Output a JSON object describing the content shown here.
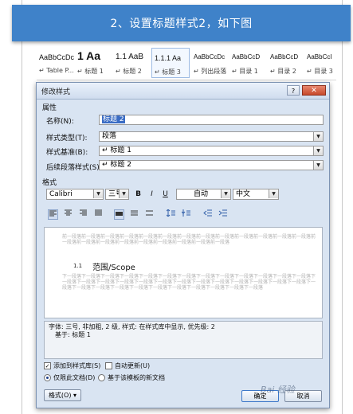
{
  "banner": {
    "text": "2、设置标题样式2，如下图"
  },
  "gallery": {
    "tiles": [
      {
        "sample": "AaBbCcDc",
        "name": "↵ Table P..."
      },
      {
        "sample": "1  Aa",
        "name": "↵ 标题 1"
      },
      {
        "sample": "1.1 AaB",
        "name": "↵ 标题 2"
      },
      {
        "sample": "1.1.1 Aa",
        "name": "↵ 标题 3"
      },
      {
        "sample": "AaBbCcDc",
        "name": "↵ 列出段落"
      },
      {
        "sample": "AaBbCcD",
        "name": "↵ 目录 1"
      },
      {
        "sample": "AaBbCcD",
        "name": "↵ 目录 2"
      },
      {
        "sample": "AaBbCcI",
        "name": "↵ 目录 3"
      }
    ]
  },
  "dialog": {
    "title": "修改样式",
    "help_label": "?",
    "close_label": "✕",
    "properties_section": "属性",
    "name_label": "名称(N):",
    "name_value": "标题 2",
    "type_label": "样式类型(T):",
    "type_value": "段落",
    "based_label": "样式基准(B):",
    "based_value": "↵ 标题 1",
    "next_label": "后续段落样式(S):",
    "next_value": "↵ 标题 2",
    "format_section": "格式",
    "font_name": "Calibri",
    "font_size": "三号",
    "bold": "B",
    "italic": "I",
    "underline": "U",
    "color_value": "自动",
    "lang_value": "中文",
    "preview_prev_text": "前一段落前一段落前一段落前一段落前一段落前一段落前一段落前一段落前一段落前一段落前一段落前一段落前一段落前一段落前一段落前一段落前一段落前一段落前一段落前一段落前一段落前一段落",
    "preview_number": "1.1",
    "preview_heading": "范围/Scope",
    "preview_next_text": "下一段落下一段落下一段落下一段落下一段落下一段落下一段落下一段落下一段落下一段落下一段落下一段落下一段落下一段落下一段落下一段落下一段落下一段落下一段落下一段落下一段落下一段落下一段落下一段落下一段落下一段落下一段落下一段落下一段落下一段落下一段落下一段落下一段落下一段落下一段落下一段落下一段落",
    "desc_line1": "字体: 三号, 非加粗, 2 级, 样式: 在样式库中显示, 优先级: 2",
    "desc_line2": "基于: 标题 1",
    "add_to_gallery": "添加到样式库(S)",
    "auto_update": "自动更新(U)",
    "only_this_doc": "仅限此文档(D)",
    "new_docs": "基于该模板的新文档",
    "format_button": "格式(O) ▾",
    "ok_button": "确定",
    "cancel_button": "取消"
  },
  "watermark": "Bai 经验"
}
